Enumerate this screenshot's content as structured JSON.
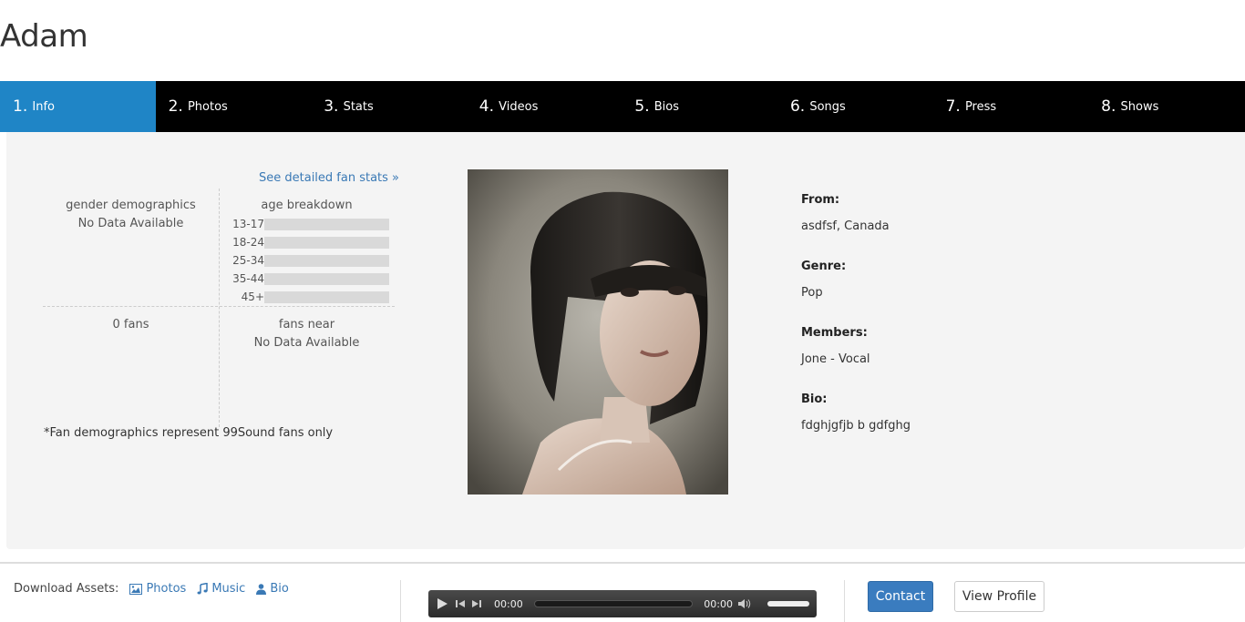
{
  "artist_name": "Adam",
  "tabs": [
    {
      "num": "1.",
      "label": "Info",
      "active": true
    },
    {
      "num": "2.",
      "label": "Photos"
    },
    {
      "num": "3.",
      "label": "Stats"
    },
    {
      "num": "4.",
      "label": "Videos"
    },
    {
      "num": "5.",
      "label": "Bios"
    },
    {
      "num": "6.",
      "label": "Songs"
    },
    {
      "num": "7.",
      "label": "Press"
    },
    {
      "num": "8.",
      "label": "Shows"
    }
  ],
  "stats": {
    "detailed_link": "See detailed fan stats »",
    "gender_heading": "gender demographics",
    "gender_value": "No Data Available",
    "age_heading": "age breakdown",
    "age_ranges": [
      "13-17",
      "18-24",
      "25-34",
      "35-44",
      "45+"
    ],
    "fans_count": "0  fans",
    "fans_near_heading": "fans near",
    "fans_near_value": "No Data Available",
    "note": "*Fan demographics represent 99Sound fans only"
  },
  "details": {
    "from_label": "From:",
    "from_value": "asdfsf, Canada",
    "genre_label": "Genre:",
    "genre_value": "Pop",
    "members_label": "Members:",
    "members_value": "Jone - Vocal",
    "bio_label": "Bio:",
    "bio_value": "fdghjgfjb b gdfghg"
  },
  "footer": {
    "download_label": "Download Assets:",
    "photos": "Photos",
    "music": "Music",
    "bio": "Bio",
    "player_time_current": "00:00",
    "player_time_total": "00:00",
    "contact_button": "Contact",
    "view_profile_button": "View Profile"
  },
  "colors": {
    "active_tab": "#1f85c6",
    "link": "#3a79b5",
    "contact_button": "#3a7cbf"
  }
}
